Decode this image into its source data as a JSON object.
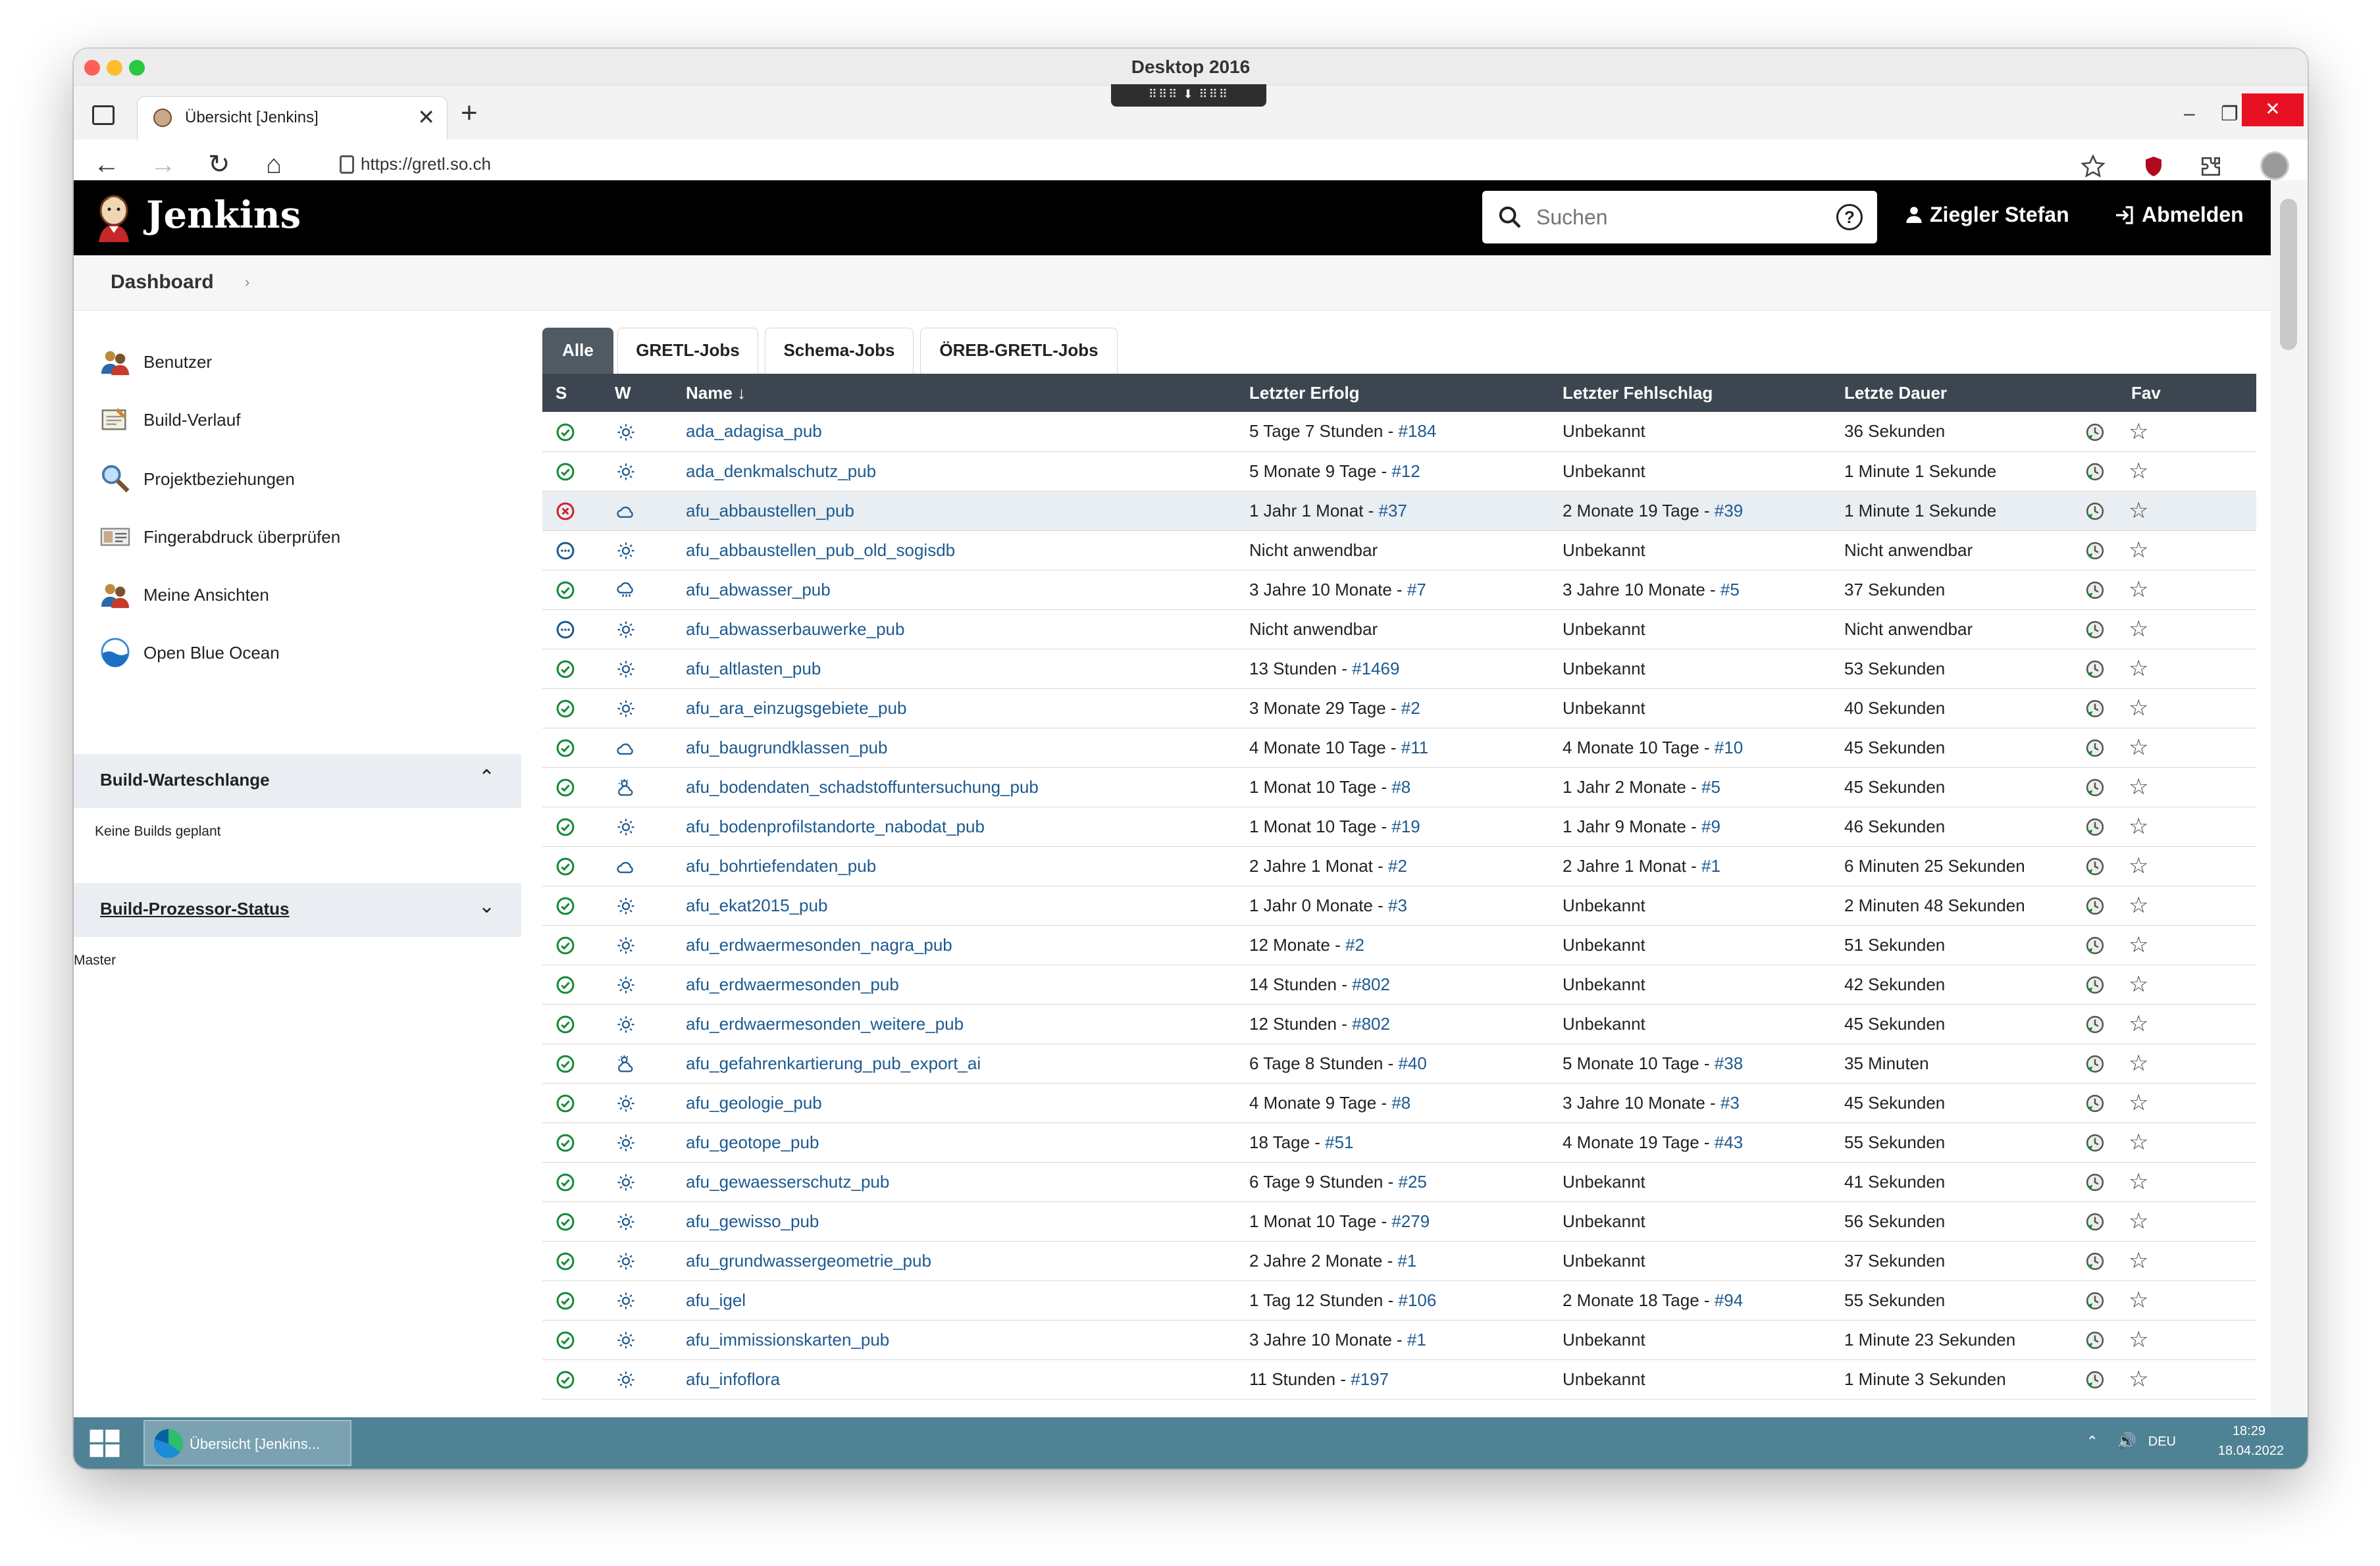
{
  "window": {
    "title": "Desktop 2016",
    "rdp_bar": "⠿⠿⠿ ⬇ ⠿⠿⠿"
  },
  "browser": {
    "tab_title": "Übersicht [Jenkins]",
    "url": "https://gretl.so.ch",
    "tab_close": "✕",
    "new_tab": "+",
    "min": "–",
    "restore": "❐",
    "close": "✕",
    "back": "←",
    "forward": "→",
    "reload": "↻",
    "home": "⌂",
    "more": "⋯"
  },
  "header": {
    "brand": "Jenkins",
    "search_placeholder": "Suchen",
    "help": "?",
    "user": "Ziegler Stefan",
    "logout": "Abmelden"
  },
  "breadcrumb": {
    "dashboard": "Dashboard",
    "arrow": "›"
  },
  "sidebar": {
    "items": [
      {
        "label": "Benutzer",
        "icon": "users-icon"
      },
      {
        "label": "Build-Verlauf",
        "icon": "notepad-icon"
      },
      {
        "label": "Projektbeziehungen",
        "icon": "magnifier-icon"
      },
      {
        "label": "Fingerabdruck überprüfen",
        "icon": "fingerprint-card-icon"
      },
      {
        "label": "Meine Ansichten",
        "icon": "users-icon"
      },
      {
        "label": "Open Blue Ocean",
        "icon": "blue-ocean-icon"
      }
    ],
    "queue": {
      "title": "Build-Warteschlange",
      "body": "Keine Builds geplant",
      "toggle": "⌃"
    },
    "executors": {
      "title": "Build-Prozessor-Status",
      "body": "Master",
      "toggle": "⌄"
    }
  },
  "view_tabs": [
    "Alle",
    "GRETL-Jobs",
    "Schema-Jobs",
    "ÖREB-GRETL-Jobs"
  ],
  "table": {
    "headers": {
      "s": "S",
      "w": "W",
      "name": "Name ↓",
      "success": "Letzter Erfolg",
      "failure": "Letzter Fehlschlag",
      "duration": "Letzte Dauer",
      "fav": "Fav"
    },
    "sep": " - ",
    "rows": [
      {
        "status": "success",
        "weather": "sunny",
        "name": "ada_adagisa_pub",
        "succ": "5 Tage 7 Stunden",
        "succ_no": "#184",
        "fail": "Unbekannt",
        "fail_no": "",
        "dur": "36 Sekunden"
      },
      {
        "status": "success",
        "weather": "sunny",
        "name": "ada_denkmalschutz_pub",
        "succ": "5 Monate 9 Tage",
        "succ_no": "#12",
        "fail": "Unbekannt",
        "fail_no": "",
        "dur": "1 Minute 1 Sekunde"
      },
      {
        "status": "failure",
        "weather": "cloudy",
        "name": "afu_abbaustellen_pub",
        "succ": "1 Jahr 1 Monat",
        "succ_no": "#37",
        "fail": "2 Monate 19 Tage",
        "fail_no": "#39",
        "dur": "1 Minute 1 Sekunde"
      },
      {
        "status": "notbuilt",
        "weather": "sunny",
        "name": "afu_abbaustellen_pub_old_sogisdb",
        "succ": "Nicht anwendbar",
        "succ_no": "",
        "fail": "Unbekannt",
        "fail_no": "",
        "dur": "Nicht anwendbar"
      },
      {
        "status": "success",
        "weather": "rainy",
        "name": "afu_abwasser_pub",
        "succ": "3 Jahre 10 Monate",
        "succ_no": "#7",
        "fail": "3 Jahre 10 Monate",
        "fail_no": "#5",
        "dur": "37 Sekunden"
      },
      {
        "status": "notbuilt",
        "weather": "sunny",
        "name": "afu_abwasserbauwerke_pub",
        "succ": "Nicht anwendbar",
        "succ_no": "",
        "fail": "Unbekannt",
        "fail_no": "",
        "dur": "Nicht anwendbar"
      },
      {
        "status": "success",
        "weather": "sunny",
        "name": "afu_altlasten_pub",
        "succ": "13 Stunden",
        "succ_no": "#1469",
        "fail": "Unbekannt",
        "fail_no": "",
        "dur": "53 Sekunden"
      },
      {
        "status": "success",
        "weather": "sunny",
        "name": "afu_ara_einzugsgebiete_pub",
        "succ": "3 Monate 29 Tage",
        "succ_no": "#2",
        "fail": "Unbekannt",
        "fail_no": "",
        "dur": "40 Sekunden"
      },
      {
        "status": "success",
        "weather": "cloudy",
        "name": "afu_baugrundklassen_pub",
        "succ": "4 Monate 10 Tage",
        "succ_no": "#11",
        "fail": "4 Monate 10 Tage",
        "fail_no": "#10",
        "dur": "45 Sekunden"
      },
      {
        "status": "success",
        "weather": "partly",
        "name": "afu_bodendaten_schadstoffuntersuchung_pub",
        "succ": "1 Monat 10 Tage",
        "succ_no": "#8",
        "fail": "1 Jahr 2 Monate",
        "fail_no": "#5",
        "dur": "45 Sekunden"
      },
      {
        "status": "success",
        "weather": "sunny",
        "name": "afu_bodenprofilstandorte_nabodat_pub",
        "succ": "1 Monat 10 Tage",
        "succ_no": "#19",
        "fail": "1 Jahr 9 Monate",
        "fail_no": "#9",
        "dur": "46 Sekunden"
      },
      {
        "status": "success",
        "weather": "cloudy",
        "name": "afu_bohrtiefendaten_pub",
        "succ": "2 Jahre 1 Monat",
        "succ_no": "#2",
        "fail": "2 Jahre 1 Monat",
        "fail_no": "#1",
        "dur": "6 Minuten 25 Sekunden"
      },
      {
        "status": "success",
        "weather": "sunny",
        "name": "afu_ekat2015_pub",
        "succ": "1 Jahr 0 Monate",
        "succ_no": "#3",
        "fail": "Unbekannt",
        "fail_no": "",
        "dur": "2 Minuten 48 Sekunden"
      },
      {
        "status": "success",
        "weather": "sunny",
        "name": "afu_erdwaermesonden_nagra_pub",
        "succ": "12 Monate",
        "succ_no": "#2",
        "fail": "Unbekannt",
        "fail_no": "",
        "dur": "51 Sekunden"
      },
      {
        "status": "success",
        "weather": "sunny",
        "name": "afu_erdwaermesonden_pub",
        "succ": "14 Stunden",
        "succ_no": "#802",
        "fail": "Unbekannt",
        "fail_no": "",
        "dur": "42 Sekunden"
      },
      {
        "status": "success",
        "weather": "sunny",
        "name": "afu_erdwaermesonden_weitere_pub",
        "succ": "12 Stunden",
        "succ_no": "#802",
        "fail": "Unbekannt",
        "fail_no": "",
        "dur": "45 Sekunden"
      },
      {
        "status": "success",
        "weather": "partly",
        "name": "afu_gefahrenkartierung_pub_export_ai",
        "succ": "6 Tage 8 Stunden",
        "succ_no": "#40",
        "fail": "5 Monate 10 Tage",
        "fail_no": "#38",
        "dur": "35 Minuten"
      },
      {
        "status": "success",
        "weather": "sunny",
        "name": "afu_geologie_pub",
        "succ": "4 Monate 9 Tage",
        "succ_no": "#8",
        "fail": "3 Jahre 10 Monate",
        "fail_no": "#3",
        "dur": "45 Sekunden"
      },
      {
        "status": "success",
        "weather": "sunny",
        "name": "afu_geotope_pub",
        "succ": "18 Tage",
        "succ_no": "#51",
        "fail": "4 Monate 19 Tage",
        "fail_no": "#43",
        "dur": "55 Sekunden"
      },
      {
        "status": "success",
        "weather": "sunny",
        "name": "afu_gewaesserschutz_pub",
        "succ": "6 Tage 9 Stunden",
        "succ_no": "#25",
        "fail": "Unbekannt",
        "fail_no": "",
        "dur": "41 Sekunden"
      },
      {
        "status": "success",
        "weather": "sunny",
        "name": "afu_gewisso_pub",
        "succ": "1 Monat 10 Tage",
        "succ_no": "#279",
        "fail": "Unbekannt",
        "fail_no": "",
        "dur": "56 Sekunden"
      },
      {
        "status": "success",
        "weather": "sunny",
        "name": "afu_grundwassergeometrie_pub",
        "succ": "2 Jahre 2 Monate",
        "succ_no": "#1",
        "fail": "Unbekannt",
        "fail_no": "",
        "dur": "37 Sekunden"
      },
      {
        "status": "success",
        "weather": "sunny",
        "name": "afu_igel",
        "succ": "1 Tag 12 Stunden",
        "succ_no": "#106",
        "fail": "2 Monate 18 Tage",
        "fail_no": "#94",
        "dur": "55 Sekunden"
      },
      {
        "status": "success",
        "weather": "sunny",
        "name": "afu_immissionskarten_pub",
        "succ": "3 Jahre 10 Monate",
        "succ_no": "#1",
        "fail": "Unbekannt",
        "fail_no": "",
        "dur": "1 Minute 23 Sekunden"
      },
      {
        "status": "success",
        "weather": "sunny",
        "name": "afu_infoflora",
        "succ": "11 Stunden",
        "succ_no": "#197",
        "fail": "Unbekannt",
        "fail_no": "",
        "dur": "1 Minute 3 Sekunden"
      }
    ],
    "highlight_row": 2,
    "fav_symbol": "☆"
  },
  "taskbar": {
    "item": "Übersicht [Jenkins...",
    "tray_arrow": "⌃",
    "volume": "🔊",
    "lang": "DEU",
    "time": "18:29",
    "date": "18.04.2022"
  },
  "colors": {
    "accent_link": "#1d5a8f",
    "success": "#138a36",
    "failure": "#d01f2a",
    "notbuilt": "#1d5a8f",
    "header_bg": "#000000",
    "table_header": "#3d4650",
    "taskbar": "#4f8294"
  }
}
